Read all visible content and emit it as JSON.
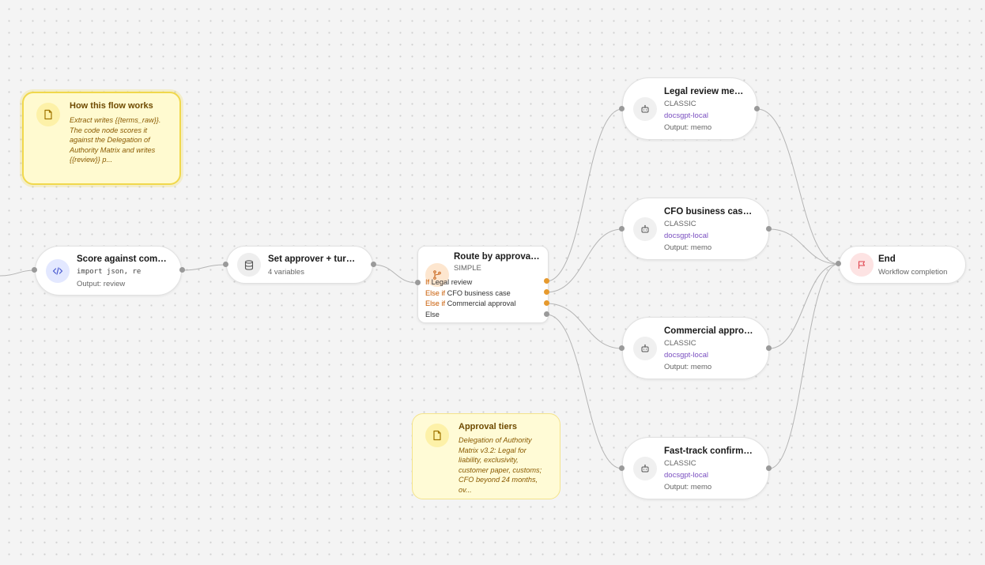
{
  "notes": {
    "how": {
      "title": "How this flow works",
      "body": "Extract writes {{terms_raw}}. The code node scores it against the Delegation of Authority Matrix and writes {{review}} p..."
    },
    "tiers": {
      "title": "Approval tiers",
      "body": "Delegation of Authority Matrix v3.2: Legal for liability, exclusivity, customer paper, customs; CFO beyond 24 months, ov..."
    }
  },
  "nodes": {
    "score": {
      "title": "Score against comm...",
      "code": "import json, re",
      "output": "Output: review"
    },
    "set_approver": {
      "title": "Set approver + turna...",
      "sub": "4 variables"
    },
    "route": {
      "title": "Route by approval ...",
      "sub": "SIMPLE",
      "conditions": [
        {
          "keyword": "If",
          "label": "Legal review"
        },
        {
          "keyword": "Else if",
          "label": "CFO business case"
        },
        {
          "keyword": "Else if",
          "label": "Commercial approval"
        },
        {
          "keyword": "",
          "label": "Else"
        }
      ]
    },
    "legal": {
      "title": "Legal review memo",
      "type": "CLASSIC",
      "model": "docsgpt-local",
      "output": "Output: memo"
    },
    "cfo": {
      "title": "CFO business case ...",
      "type": "CLASSIC",
      "model": "docsgpt-local",
      "output": "Output: memo"
    },
    "commercial": {
      "title": "Commercial approva...",
      "type": "CLASSIC",
      "model": "docsgpt-local",
      "output": "Output: memo"
    },
    "fasttrack": {
      "title": "Fast-track confirmat...",
      "type": "CLASSIC",
      "model": "docsgpt-local",
      "output": "Output: memo"
    },
    "end": {
      "title": "End",
      "sub": "Workflow completion"
    }
  },
  "colors": {
    "accent_orange": "#e69a2e",
    "model_purple": "#7a4fc0",
    "note_yellow": "#fffbd6",
    "end_red": "#e0454f"
  },
  "icons": {
    "note": "note-icon",
    "code": "code-icon",
    "database": "database-icon",
    "branch": "branch-icon",
    "bot": "bot-icon",
    "flag": "flag-icon"
  }
}
